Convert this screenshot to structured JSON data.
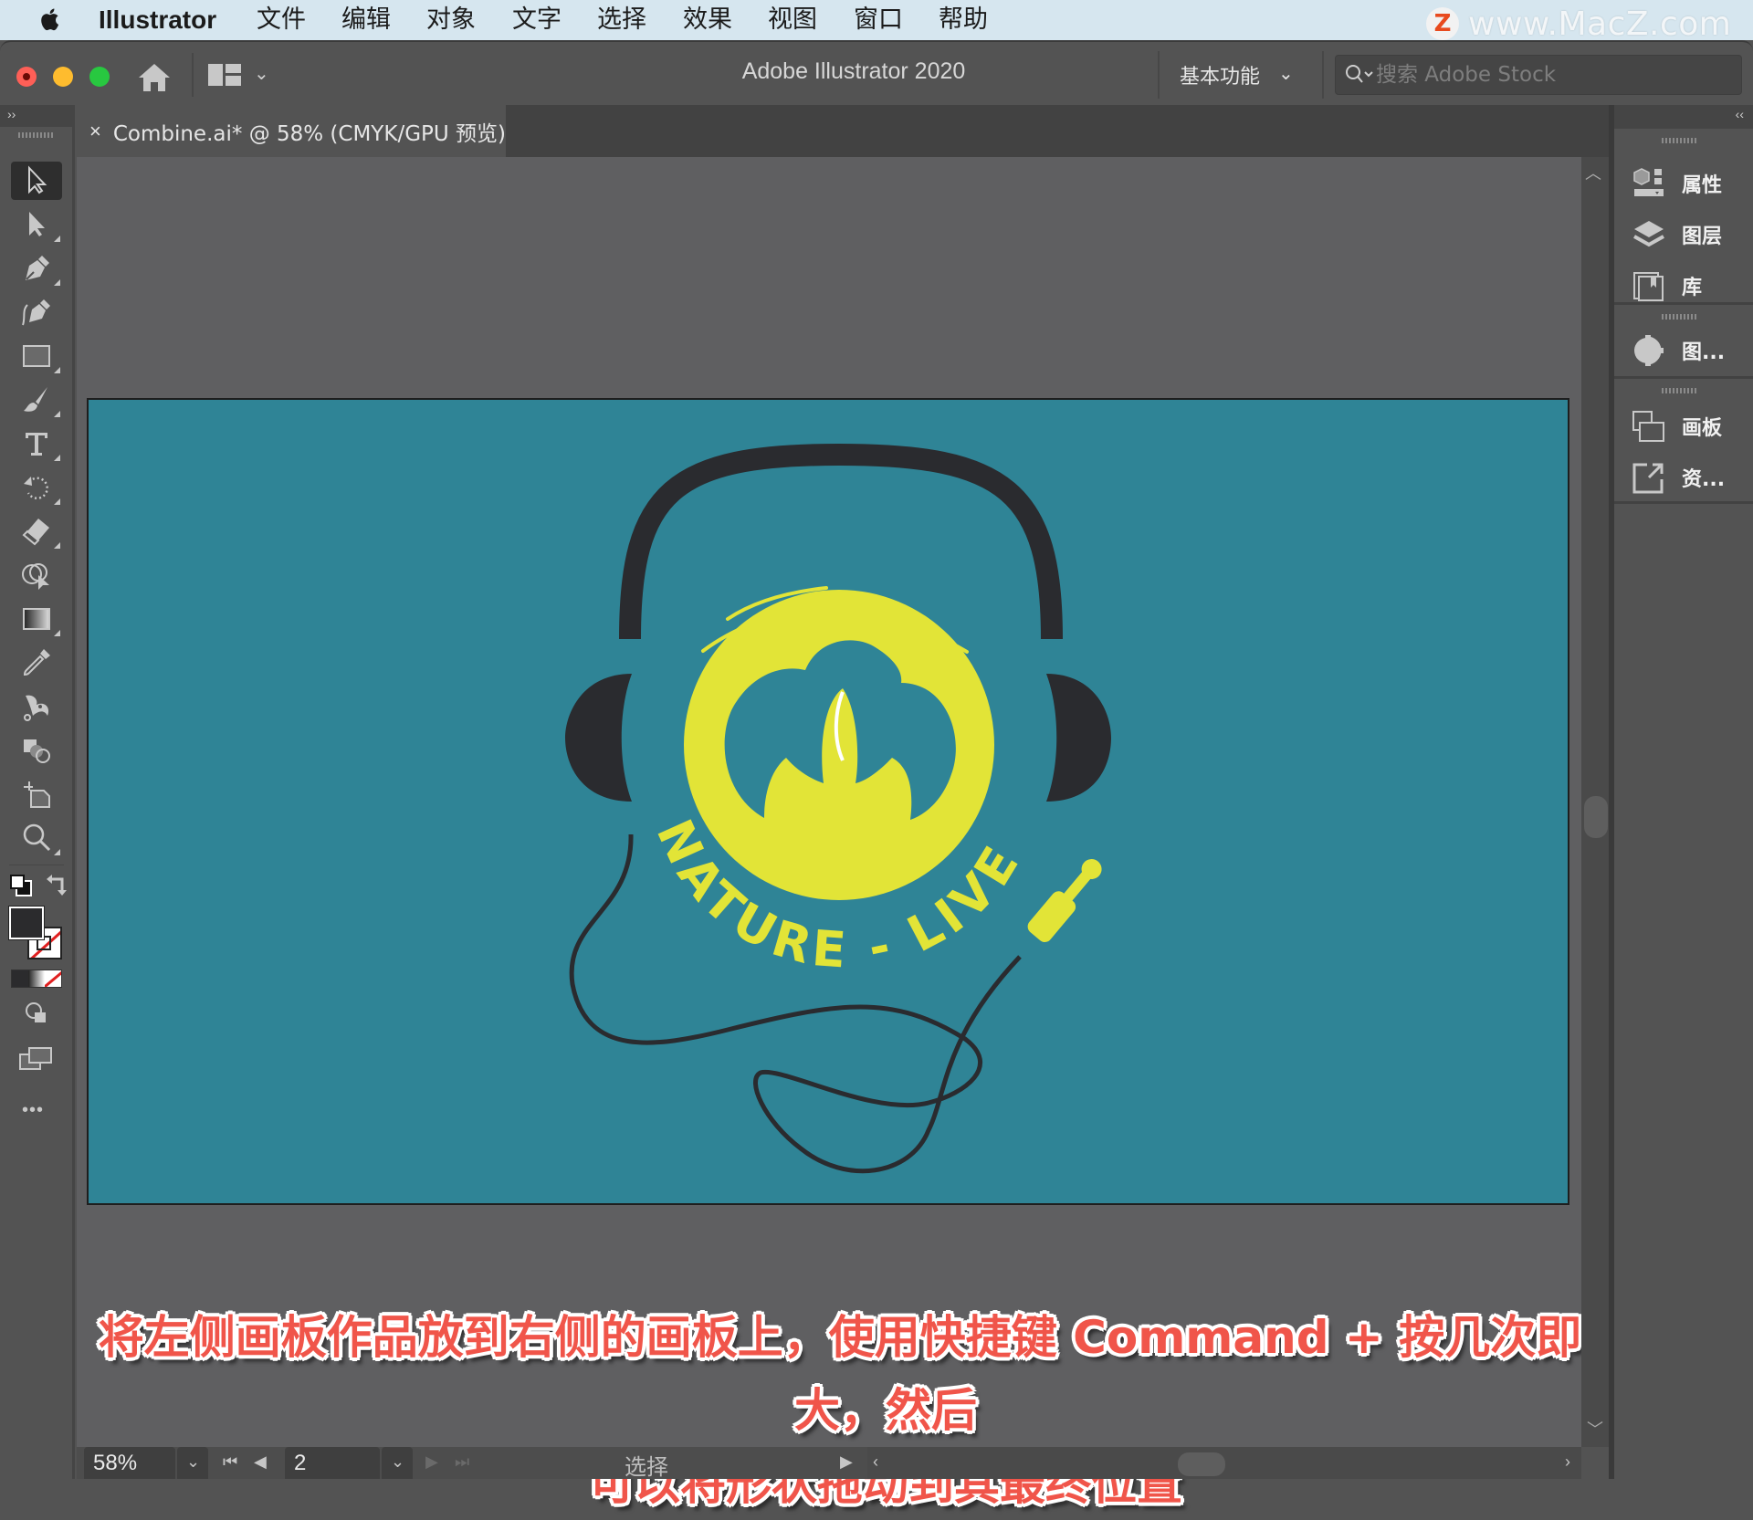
{
  "menubar": {
    "app_name": "Illustrator",
    "items": [
      "文件",
      "编辑",
      "对象",
      "文字",
      "选择",
      "效果",
      "视图",
      "窗口",
      "帮助"
    ]
  },
  "watermark": {
    "logo_letter": "Z",
    "text": "www.MacZ.com"
  },
  "appbar": {
    "title": "Adobe Illustrator 2020",
    "workspace": "基本功能",
    "search_placeholder": "搜索 Adobe Stock"
  },
  "document_tab": {
    "close": "×",
    "title": "Combine.ai* @ 58% (CMYK/GPU 预览)"
  },
  "toolbar": {
    "collapse": "››",
    "tools": [
      {
        "name": "selection-tool",
        "active": true
      },
      {
        "name": "direct-selection-tool"
      },
      {
        "name": "pen-tool"
      },
      {
        "name": "curvature-tool"
      },
      {
        "name": "rectangle-tool"
      },
      {
        "name": "paintbrush-tool"
      },
      {
        "name": "type-tool"
      },
      {
        "name": "rotate-tool"
      },
      {
        "name": "eraser-tool"
      },
      {
        "name": "shape-builder-tool"
      },
      {
        "name": "gradient-tool"
      },
      {
        "name": "eyedropper-tool"
      },
      {
        "name": "puppet-warp-tool"
      },
      {
        "name": "blend-tool"
      },
      {
        "name": "artboard-tool"
      },
      {
        "name": "zoom-tool"
      }
    ],
    "fill_color": "#2b2b2d",
    "more": "•••"
  },
  "right_panel": {
    "collapse": "‹‹",
    "groups": [
      {
        "items": [
          {
            "icon": "properties-icon",
            "label": "属性"
          },
          {
            "icon": "layers-icon",
            "label": "图层"
          },
          {
            "icon": "libraries-icon",
            "label": "库"
          }
        ]
      },
      {
        "items": [
          {
            "icon": "graphic-styles-icon",
            "label": "图..."
          }
        ]
      },
      {
        "items": [
          {
            "icon": "artboards-icon",
            "label": "画板"
          },
          {
            "icon": "asset-export-icon",
            "label": "资..."
          }
        ]
      }
    ]
  },
  "artwork": {
    "background": "#2f8496",
    "text": "NATURE - LIVE",
    "yellow": "#e2e437",
    "dark": "#2a2b2f"
  },
  "statusbar": {
    "zoom": "58%",
    "artboard_number": "2",
    "tool_display": "选择"
  },
  "caption": {
    "line1": "将左侧画板作品放到右侧的画板上，使用快捷键 Command + 按几次即可放大，然后",
    "line2": "可以将形状拖动到其最终位置"
  }
}
